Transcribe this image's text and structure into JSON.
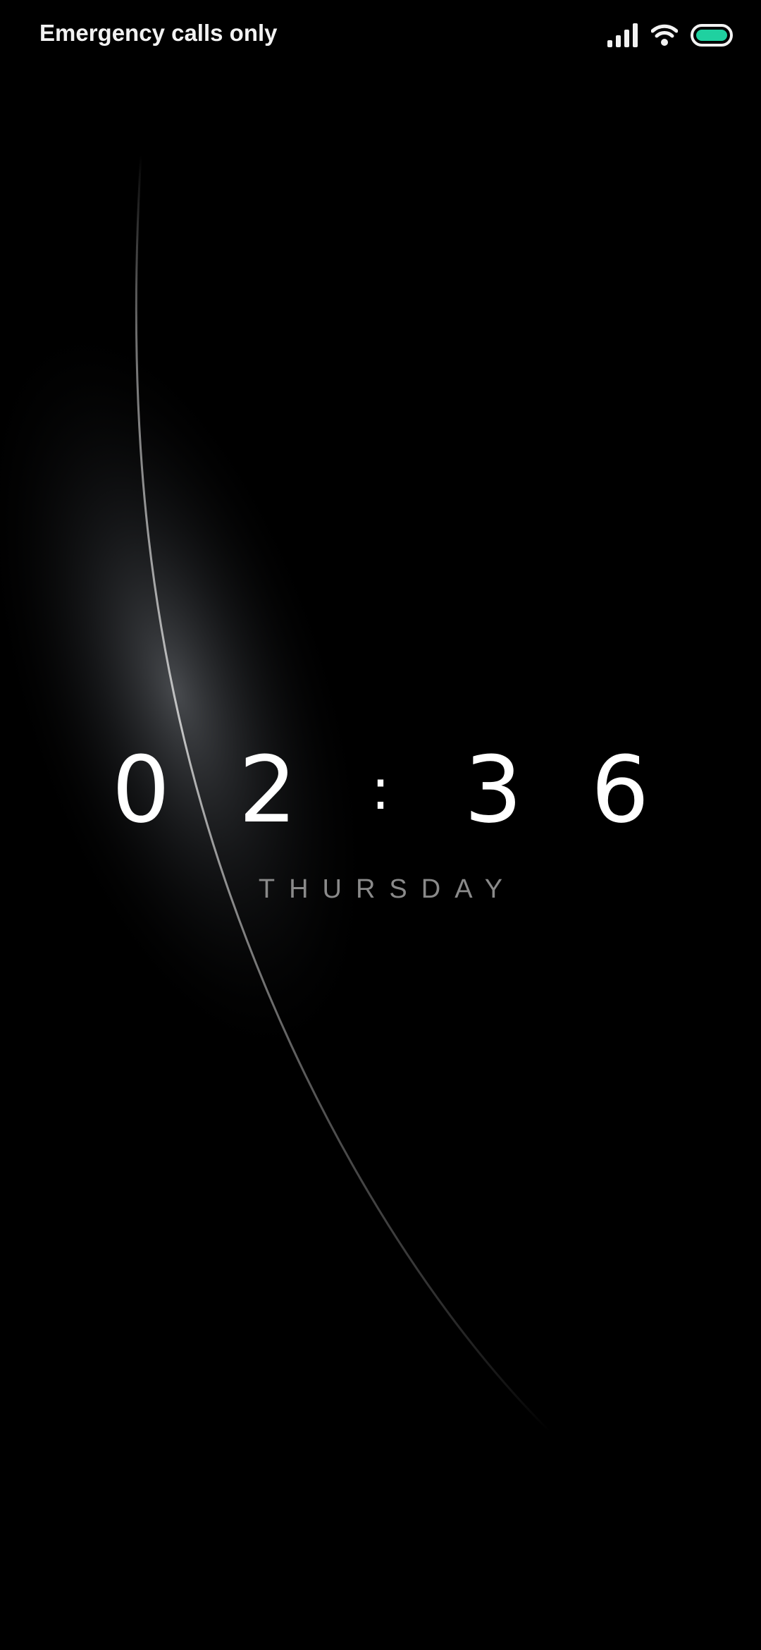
{
  "status_bar": {
    "carrier_text": "Emergency calls only",
    "icons": [
      "signal-icon",
      "wifi-icon",
      "battery-icon"
    ],
    "battery_color": "#1fd1a0"
  },
  "lockscreen": {
    "time": {
      "d1": "0",
      "d2": "2",
      "separator": ":",
      "d3": "3",
      "d4": "6"
    },
    "day": "THURSDAY"
  }
}
